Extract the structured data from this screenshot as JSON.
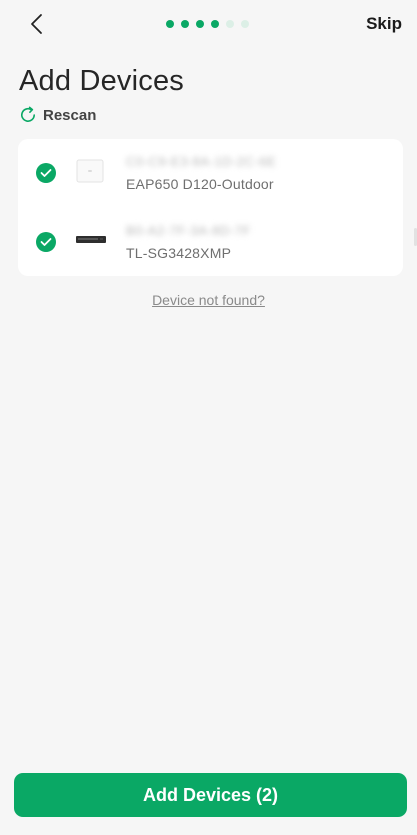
{
  "header": {
    "skip_label": "Skip",
    "progress": {
      "total_steps": 6,
      "current_step": 4
    }
  },
  "page": {
    "title": "Add Devices"
  },
  "rescan": {
    "label": "Rescan"
  },
  "devices": [
    {
      "mac": "C0-C9-E3-8A-1D-2C-6E",
      "model": "EAP650 D120-Outdoor",
      "selected": true,
      "type": "access-point"
    },
    {
      "mac": "B0-A2-7F-3A-8D-7F",
      "model": "TL-SG3428XMP",
      "selected": true,
      "type": "switch"
    }
  ],
  "device_not_found_label": "Device not found?",
  "primary_action": {
    "label": "Add Devices (2)"
  },
  "colors": {
    "accent": "#0aa865",
    "background": "#f6f6f6",
    "card": "#ffffff"
  }
}
